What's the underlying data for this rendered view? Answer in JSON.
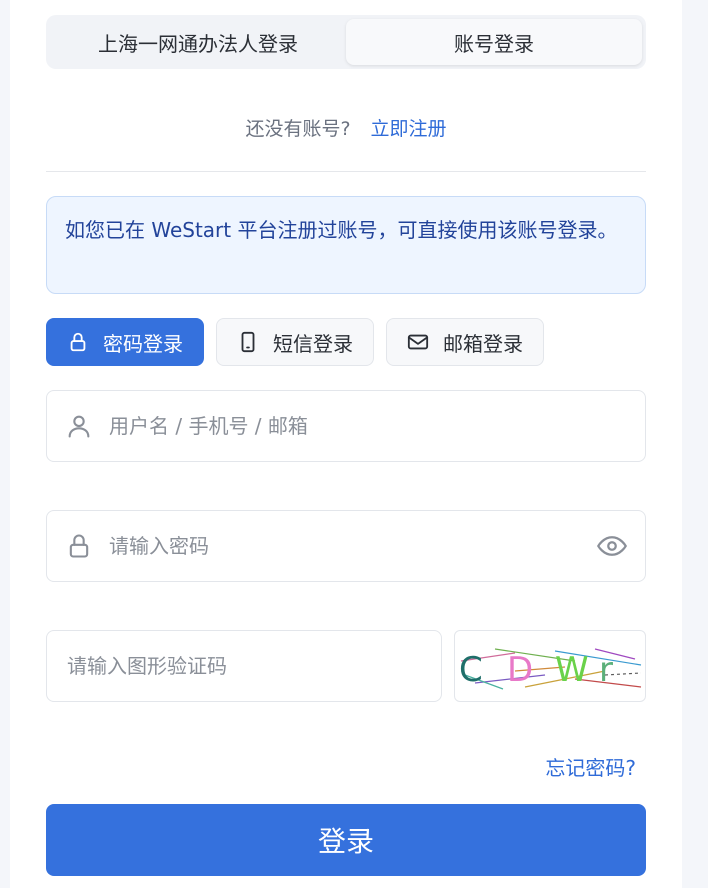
{
  "tabs": [
    {
      "label": "上海一网通办法人登录",
      "active": false
    },
    {
      "label": "账号登录",
      "active": true
    }
  ],
  "register": {
    "question": "还没有账号?",
    "link": "立即注册"
  },
  "notice": {
    "text": "如您已在 WeStart 平台注册过账号，可直接使用该账号登录。"
  },
  "login_methods": [
    {
      "label": "密码登录",
      "icon": "lock-icon",
      "active": true
    },
    {
      "label": "短信登录",
      "icon": "phone-icon",
      "active": false
    },
    {
      "label": "邮箱登录",
      "icon": "mail-icon",
      "active": false
    }
  ],
  "username": {
    "placeholder": "用户名 / 手机号 / 邮箱",
    "icon": "user-icon"
  },
  "password": {
    "placeholder": "请输入密码",
    "icon": "lock-icon",
    "toggle_icon": "eye-icon"
  },
  "captcha": {
    "placeholder": "请输入图形验证码",
    "code": "CDWr"
  },
  "forgot": "忘记密码?",
  "submit": "登录",
  "colors": {
    "primary": "#3571dd",
    "link": "#2f6bd8",
    "notice_bg": "#eef5ff",
    "notice_text": "#22439a"
  }
}
